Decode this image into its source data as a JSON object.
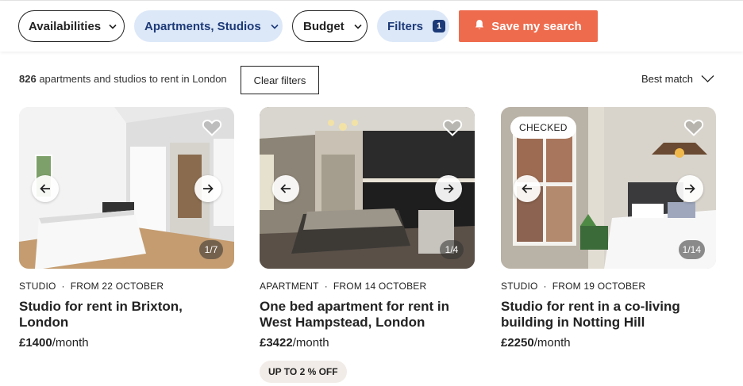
{
  "filters": {
    "availabilities": "Availabilities",
    "type": "Apartments, Studios",
    "budget": "Budget",
    "filters": "Filters",
    "filters_count": "1",
    "save_search": "Save my search"
  },
  "results": {
    "count": "826",
    "count_suffix": "apartments and studios to rent in London",
    "clear_filters": "Clear filters",
    "sort": "Best match"
  },
  "listings": [
    {
      "type": "STUDIO",
      "availability": "FROM 22 OCTOBER",
      "title": "Studio for rent in Brixton, London",
      "price": "£1400",
      "period": "/month",
      "photo_counter": "1/7"
    },
    {
      "type": "APARTMENT",
      "availability": "FROM 14 OCTOBER",
      "title": "One bed apartment for rent in West Hampstead, London",
      "price": "£3422",
      "period": "/month",
      "photo_counter": "1/4",
      "discount": "UP TO 2 % OFF"
    },
    {
      "type": "STUDIO",
      "availability": "FROM 19 OCTOBER",
      "title": "Studio for rent in a co-living building in Notting Hill",
      "price": "£2250",
      "period": "/month",
      "photo_counter": "1/14",
      "tag": "CHECKED"
    }
  ],
  "colors": {
    "accent": "#ee6b4d",
    "filter_active_bg": "#dce8f8",
    "filter_active_text": "#1d3a78"
  },
  "icons": [
    "chevron-down-icon",
    "bell-icon",
    "heart-icon",
    "arrow-left-icon",
    "arrow-right-icon"
  ]
}
